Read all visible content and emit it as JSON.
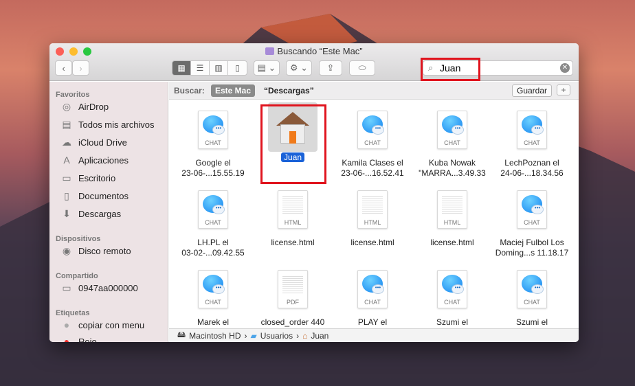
{
  "window": {
    "title": "Buscando “Este Mac”"
  },
  "toolbar": {
    "back": "‹",
    "forward": "›",
    "views": [
      "▦",
      "☰",
      "▥",
      "▯"
    ],
    "search_value": "Juan"
  },
  "sidebar": {
    "sections": [
      {
        "label": "Favoritos",
        "items": [
          {
            "label": "AirDrop",
            "icon": "airdrop-icon"
          },
          {
            "label": "Todos mis archivos",
            "icon": "all-files-icon"
          },
          {
            "label": "iCloud Drive",
            "icon": "cloud-icon"
          },
          {
            "label": "Aplicaciones",
            "icon": "applications-icon"
          },
          {
            "label": "Escritorio",
            "icon": "desktop-icon"
          },
          {
            "label": "Documentos",
            "icon": "documents-icon"
          },
          {
            "label": "Descargas",
            "icon": "downloads-icon"
          }
        ]
      },
      {
        "label": "Dispositivos",
        "items": [
          {
            "label": "Disco remoto",
            "icon": "disc-icon"
          }
        ]
      },
      {
        "label": "Compartido",
        "items": [
          {
            "label": "0947aa000000",
            "icon": "computer-icon"
          }
        ]
      },
      {
        "label": "Etiquetas",
        "items": [
          {
            "label": "copiar con menu",
            "icon": "gray-tag-icon"
          },
          {
            "label": "Rojo",
            "icon": "red-tag-icon"
          }
        ]
      }
    ]
  },
  "scope": {
    "label": "Buscar:",
    "this_mac": "Este Mac",
    "downloads": "“Descargas”",
    "save": "Guardar",
    "add": "+"
  },
  "files": [
    {
      "name": "Google el\n23-06-...15.55.19",
      "type": "CHAT"
    },
    {
      "name": "Juan",
      "type": "folder",
      "selected": true
    },
    {
      "name": "Kamila Clases el\n23-06-...16.52.41",
      "type": "CHAT"
    },
    {
      "name": "Kuba Nowak\n\"MARRA...3.49.33",
      "type": "CHAT"
    },
    {
      "name": "LechPoznan el\n24-06-...18.34.56",
      "type": "CHAT"
    },
    {
      "name": "LH.PL el\n03-02-...09.42.55",
      "type": "CHAT"
    },
    {
      "name": "license.html",
      "type": "HTML"
    },
    {
      "name": "license.html",
      "type": "HTML"
    },
    {
      "name": "license.html",
      "type": "HTML"
    },
    {
      "name": "Maciej Fulbol Los\nDoming...s 11.18.17",
      "type": "CHAT"
    },
    {
      "name": "Marek el",
      "type": "CHAT"
    },
    {
      "name": "closed_order 440",
      "type": "PDF"
    },
    {
      "name": "PLAY el",
      "type": "CHAT"
    },
    {
      "name": "Szumi el",
      "type": "CHAT"
    },
    {
      "name": "Szumi el",
      "type": "CHAT"
    }
  ],
  "pathbar": [
    "Macintosh HD",
    "Usuarios",
    "Juan"
  ],
  "colors": {
    "highlight": "#e0141e",
    "selection": "#1a62d8"
  }
}
